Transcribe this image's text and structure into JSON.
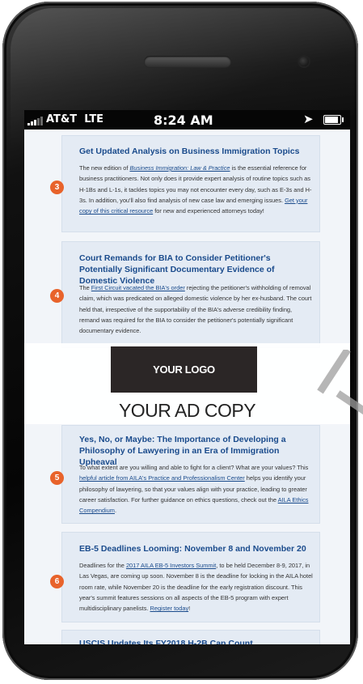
{
  "status_bar": {
    "carrier": "AT&T",
    "network": "LTE",
    "time": "8:24 AM"
  },
  "articles": [
    {
      "number": "3",
      "title": "Get Updated Analysis on Business Immigration Topics",
      "body_before": "The new edition of ",
      "link1": "Business Immigration: Law & Practice",
      "body_middle": " is the essential reference for business practitioners. Not only does it provide expert analysis of routine topics such as H-1Bs and L-1s, it tackles topics you may not encounter every day, such as E-3s and H-3s. In addition, you'll also find analysis of new case law and emerging issues. ",
      "link2": "Get your copy of this critical resource",
      "body_after": " for new and experienced attorneys today!"
    },
    {
      "number": "4",
      "title": "Court Remands for BIA to Consider Petitioner's Potentially Significant Documentary Evidence of Domestic Violence",
      "link1": "First Circuit vacated the BIA's order",
      "body_before": "The ",
      "body_after": " rejecting the petitioner's withholding of removal claim, which was predicated on alleged domestic violence by her ex-husband. The court held that, irrespective of the supportability of the BIA's adverse credibility finding, remand was required for the BIA to consider the petitioner's potentially significant documentary evidence."
    },
    {
      "number": "5",
      "title": "Yes, No, or Maybe: The Importance of Developing a Philosophy of Lawyering in an Era of Immigration Upheaval",
      "body_before": "To what extent are you willing and able to fight for a client? What are your values? This ",
      "link1": "helpful article from AILA's Practice and Professionalism Center",
      "body_middle": " helps you identify your philosophy of lawyering, so that your values align with your practice, leading to greater career satisfaction. For further guidance on ethics questions, check out the ",
      "link2": "AILA Ethics Compendium",
      "body_after": "."
    },
    {
      "number": "6",
      "title": "EB-5 Deadlines Looming: November 8 and November 20",
      "body_before": "Deadlines for the ",
      "link1": "2017 AILA EB-5 Investors Summit",
      "body_middle": ", to be held December 8-9, 2017, in Las Vegas, are coming up soon. November 8 is the deadline for locking in the AILA hotel room rate, while November 20 is the deadline for the early registration discount. This year's summit features sessions on all aspects of the EB-5 program with expert multidisciplinary panelists. ",
      "link2": "Register today",
      "body_after": "!"
    },
    {
      "title": "USCIS Updates Its FY2018 H-2B Cap Count"
    }
  ],
  "ad": {
    "logo_text": "YOUR LOGO",
    "copy_text": "YOUR AD COPY"
  },
  "colors": {
    "accent": "#e8632b",
    "link": "#1a4b8c",
    "card_bg": "#e4ebf4"
  }
}
